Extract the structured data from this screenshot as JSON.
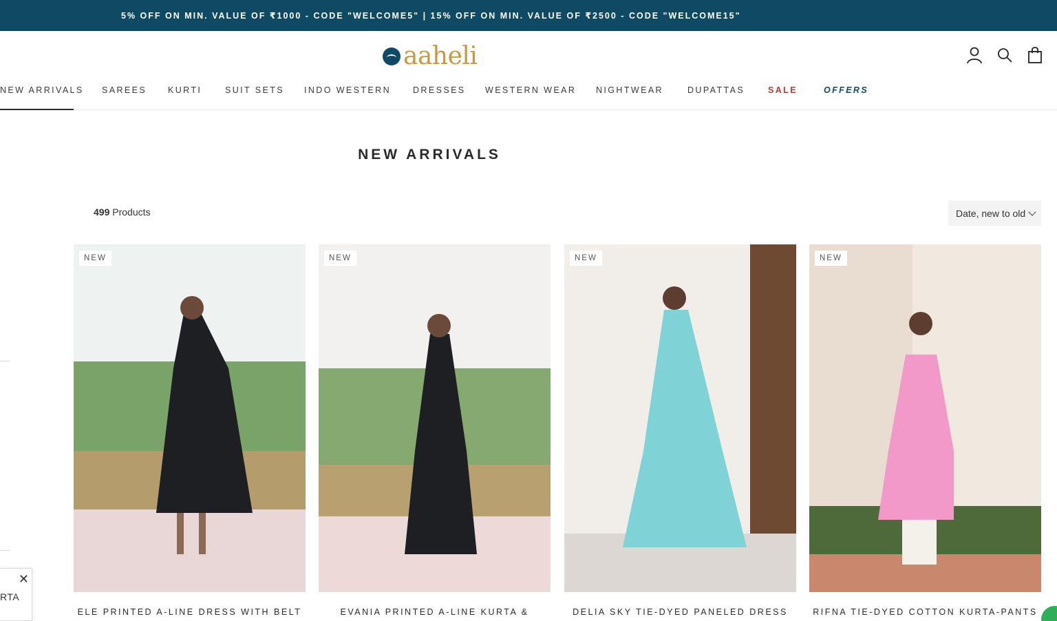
{
  "announcement": "5% OFF ON MIN. VALUE OF ₹1000 - CODE \"WELCOME5\" | 15% OFF ON MIN. VALUE OF ₹2500 - CODE \"WELCOME15\"",
  "brand": {
    "name": "aaheli",
    "accent": "#0e4a63",
    "gold": "#c69a45"
  },
  "header": {
    "icons": [
      "account-icon",
      "search-icon",
      "bag-icon"
    ]
  },
  "nav": [
    {
      "label": "NEW ARRIVALS",
      "active": true
    },
    {
      "label": "SAREES"
    },
    {
      "label": "KURTI"
    },
    {
      "label": "SUIT SETS"
    },
    {
      "label": "INDO WESTERN"
    },
    {
      "label": "DRESSES"
    },
    {
      "label": "WESTERN WEAR"
    },
    {
      "label": "NIGHTWEAR"
    },
    {
      "label": "DUPATTAS"
    },
    {
      "label": "SALE",
      "color": "#c0392b"
    },
    {
      "label": "OFFERS",
      "color": "#0e4a63"
    }
  ],
  "page": {
    "title": "NEW ARRIVALS",
    "count_number": "499",
    "count_suffix": "Products",
    "sort_label": "Date, new to old"
  },
  "products": [
    {
      "badge": "NEW",
      "title": "ELE PRINTED A-LINE DRESS WITH BELT",
      "dress_color": "#1d1f22"
    },
    {
      "badge": "NEW",
      "title": "EVANIA PRINTED A-LINE KURTA &",
      "dress_color": "#1d1f22"
    },
    {
      "badge": "NEW",
      "title": "DELIA SKY TIE-DYED PANELED DRESS",
      "dress_color": "#7fd3d6"
    },
    {
      "badge": "NEW",
      "title": "RIFNA TIE-DYED COTTON KURTA-PANTS",
      "dress_color": "#f199c8"
    }
  ],
  "chat": {
    "label": "RTA",
    "close": "✕"
  }
}
